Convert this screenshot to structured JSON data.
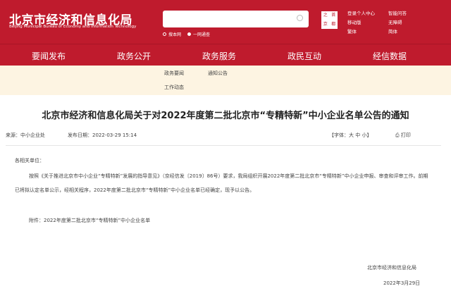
{
  "header": {
    "title": "北京市经济和信息化局",
    "subtitle": "Beijing Municipal Bureau of Economy and Information Technology",
    "search_placeholder": "",
    "search_scope": [
      "搜本网",
      "一网通查"
    ],
    "seal_text": [
      "之",
      "首",
      "京",
      "都"
    ],
    "links": [
      "登录个人中心",
      "智能问答",
      "移动版",
      "无障碍",
      "繁体",
      "简体"
    ]
  },
  "nav": [
    "要闻发布",
    "政务公开",
    "政务服务",
    "政民互动",
    "经信数据"
  ],
  "subnav": [
    "政务要闻",
    "通知公告",
    "工作动态"
  ],
  "article": {
    "title": "北京市经济和信息化局关于对2022年度第二批北京市“专精特新”中小企业名单公告的通知",
    "source": "来源：中小企业处",
    "date": "发布日期：2022-03-29 15:14",
    "font_label": "【字体：",
    "font_large": "大",
    "font_medium": "中",
    "font_small": "小",
    "font_end": "】",
    "print": "打印",
    "salutation": "各相关单位：",
    "body": "按照《关于推进北京市中小企业“专精特新”发展的指导意见》（京经信发〔2019〕86号）要求，我局组织开展2022年度第二批北京市“专精特新”中小企业申报、审查和评审工作。前期已将拟认定名单公示，经相关程序，2022年度第二批北京市“专精特新”中小企业名单已经确定，现予以公告。",
    "attachment": "附件：2022年度第二批北京市“专精特新”中小企业名单",
    "signature": "北京市经济和信息化局",
    "sign_date": "2022年3月29日"
  }
}
